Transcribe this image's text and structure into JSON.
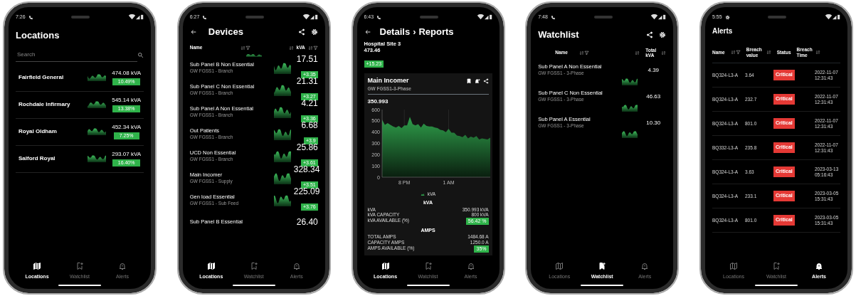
{
  "phones": [
    {
      "kind": "locations",
      "status_time": "7:26",
      "title": "Locations",
      "search": {
        "placeholder": "Search"
      },
      "locations": [
        {
          "name": "Fairfield General",
          "reading": "474.08 kVA",
          "change": "10.49%"
        },
        {
          "name": "Rochdale Infirmary",
          "reading": "545.14 kVA",
          "change": "13.38%"
        },
        {
          "name": "Royal Oldham",
          "reading": "452.34 kVA",
          "change": "7.25%"
        },
        {
          "name": "Salford Royal",
          "reading": "293.07 kVA",
          "change": "16.40%"
        }
      ],
      "nav": [
        {
          "label": "Locations",
          "selected": true
        },
        {
          "label": "Watchlist",
          "selected": false
        },
        {
          "label": "Alerts",
          "selected": false
        }
      ]
    },
    {
      "kind": "devices",
      "status_time": "6:27",
      "title": "Devices",
      "columns": [
        "Name",
        "kVA"
      ],
      "devices": [
        {
          "name": "Sub Panel B Non Essential",
          "subtitle": "GW FGSS1 - Branch",
          "value": "17.51",
          "change": "+3.35"
        },
        {
          "name": "Sub Panel C Non Essential",
          "subtitle": "GW FGSS1 - Branch",
          "value": "21.31",
          "change": "+3.27"
        },
        {
          "name": "Sub Panel A Non Essential",
          "subtitle": "GW FGSS1 - Branch",
          "value": "4.21",
          "change": "+3.36"
        },
        {
          "name": "Out Patients",
          "subtitle": "GW FGSS1 - Branch",
          "value": "6.68",
          "change": "+3.9"
        },
        {
          "name": "UCD Non Essential",
          "subtitle": "GW FGSS1 - Branch",
          "value": "25.86",
          "change": "+3.61"
        },
        {
          "name": "Main Incomer",
          "subtitle": "GW FGSS1 - Supply",
          "value": "328.34",
          "change": "+3.51"
        },
        {
          "name": "Gen load Essential",
          "subtitle": "GW FGSS1 - Sub Feed",
          "value": "225.09",
          "change": "+3.76"
        },
        {
          "name": "Sub Panel B Essential",
          "value": "26.40"
        }
      ],
      "nav": [
        {
          "label": "Locations",
          "selected": true
        },
        {
          "label": "Watchlist",
          "selected": false
        },
        {
          "label": "Alerts",
          "selected": false
        }
      ]
    },
    {
      "kind": "details",
      "status_time": "6:43",
      "title": "Details",
      "separator": "›",
      "subtitle": "Reports",
      "site": {
        "name": "Hospital Site 3",
        "value": "473.46",
        "change": "+15.23"
      },
      "card": {
        "title": "Main Incomer",
        "subtitle": "GW FGSS1-3-Phase",
        "reading": "350.993",
        "chart_data": {
          "type": "area",
          "categories": [
            null,
            null,
            null,
            null,
            null,
            null,
            null,
            null,
            "8 PM",
            null,
            null,
            null,
            null,
            null,
            null,
            null,
            null,
            null,
            null,
            null,
            null,
            null,
            null,
            null,
            "1 AM",
            null,
            null,
            null,
            null,
            null,
            null,
            null,
            null,
            null,
            null,
            null,
            null,
            null,
            null,
            null
          ],
          "series": [
            {
              "name": "kVA",
              "color": "#2e9e4a",
              "values": [
                510,
                465,
                480,
                465,
                450,
                440,
                455,
                435,
                460,
                460,
                535,
                470,
                460,
                470,
                440,
                475,
                455,
                450,
                450,
                440,
                435,
                420,
                415,
                400,
                430,
                395,
                395,
                370,
                365,
                355,
                375,
                345,
                360,
                350,
                365,
                335,
                345,
                340,
                335,
                350
              ]
            }
          ],
          "ylim": [
            0,
            600
          ],
          "yticks": [
            0,
            100,
            200,
            300,
            400,
            500,
            600
          ]
        },
        "sections": [
          {
            "heading": "kVA",
            "rows": [
              {
                "label": "kVA",
                "value": "350.993 kVA",
                "highlight": false
              },
              {
                "label": "kVA CAPACITY",
                "value": "800 kVA",
                "highlight": false
              },
              {
                "label": "kVA AVAILABLE (%)",
                "value": "56.42 %",
                "highlight": true
              }
            ]
          },
          {
            "heading": "AMPS",
            "rows": [
              {
                "label": "TOTAL AMPS",
                "value": "1484.68 A",
                "highlight": false
              },
              {
                "label": "CAPACITY AMPS",
                "value": "1250.0 A",
                "highlight": false
              },
              {
                "label": "AMPS AVAILABLE (%)",
                "value": "35%",
                "highlight": true
              }
            ]
          }
        ]
      },
      "nav": [
        {
          "label": "Locations",
          "selected": true
        },
        {
          "label": "Watchlist",
          "selected": false
        },
        {
          "label": "Alerts",
          "selected": false
        }
      ]
    },
    {
      "kind": "watchlist",
      "status_time": "7:48",
      "title": "Watchlist",
      "columns": [
        "Name",
        "Total kVA"
      ],
      "items": [
        {
          "name": "Sub Panel A Non Essential",
          "subtitle": "GW FGSS1 - 3-Phase",
          "value": "4.39"
        },
        {
          "name": "Sub Panel C Non Essential",
          "subtitle": "GW FGSS1 - 3-Phase",
          "value": "46.63"
        },
        {
          "name": "Sub Panel A Essential",
          "subtitle": "GW FGSS1 - 3-Phase",
          "value": "10.30"
        }
      ],
      "nav": [
        {
          "label": "Locations",
          "selected": false
        },
        {
          "label": "Watchlist",
          "selected": true
        },
        {
          "label": "Alerts",
          "selected": false
        }
      ]
    },
    {
      "kind": "alerts",
      "status_time": "5:55",
      "title": "Alerts",
      "columns": [
        "Name",
        "Breach value",
        "Status",
        "Breach Time"
      ],
      "alerts": [
        {
          "name": "BQ324-L3-A",
          "value": "3.64",
          "status": {
            "kind": "critical",
            "label": "Critical"
          },
          "time": "2022-11-07 12:31:43"
        },
        {
          "name": "BQ324-L3-A",
          "value": "232.7",
          "status": {
            "kind": "critical",
            "label": "Critical"
          },
          "time": "2022-11-07 12:31:43"
        },
        {
          "name": "BQ324-L3-A",
          "value": "801.0",
          "status": {
            "kind": "critical",
            "label": "Critical"
          },
          "time": "2022-11-07 12:31:43"
        },
        {
          "name": "BQ332-L3-A",
          "value": "235.8",
          "status": {
            "kind": "critical",
            "label": "Critical"
          },
          "time": "2022-11-07 12:31:43"
        },
        {
          "name": "BQ324-L3-A",
          "value": "3.63",
          "status": {
            "kind": "critical",
            "label": "Critical"
          },
          "time": "2023-03-13 05:16:43"
        },
        {
          "name": "BQ324-L3-A",
          "value": "233.1",
          "status": {
            "kind": "critical",
            "label": "Critical"
          },
          "time": "2023-03-05 15:31:43"
        },
        {
          "name": "BQ324-L3-A",
          "value": "801.0",
          "status": {
            "kind": "critical",
            "label": "Critical"
          },
          "time": "2023-03-05 15:31:43"
        }
      ],
      "nav": [
        {
          "label": "Locations",
          "selected": false
        },
        {
          "label": "Watchlist",
          "selected": false
        },
        {
          "label": "Alerts",
          "selected": true
        }
      ]
    }
  ]
}
